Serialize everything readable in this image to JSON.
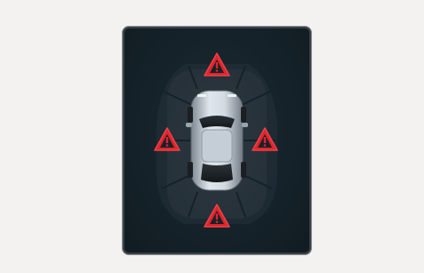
{
  "display": {
    "panel_color": "#16222a",
    "zone_color": "#2f3a40",
    "warning_color": "#e0242b",
    "warning_icon": "warning-triangle-icon",
    "car_icon": "car-top-view-icon",
    "warnings": [
      {
        "zone": "front",
        "active": true
      },
      {
        "zone": "left",
        "active": true
      },
      {
        "zone": "right",
        "active": true
      },
      {
        "zone": "rear",
        "active": true
      }
    ]
  }
}
